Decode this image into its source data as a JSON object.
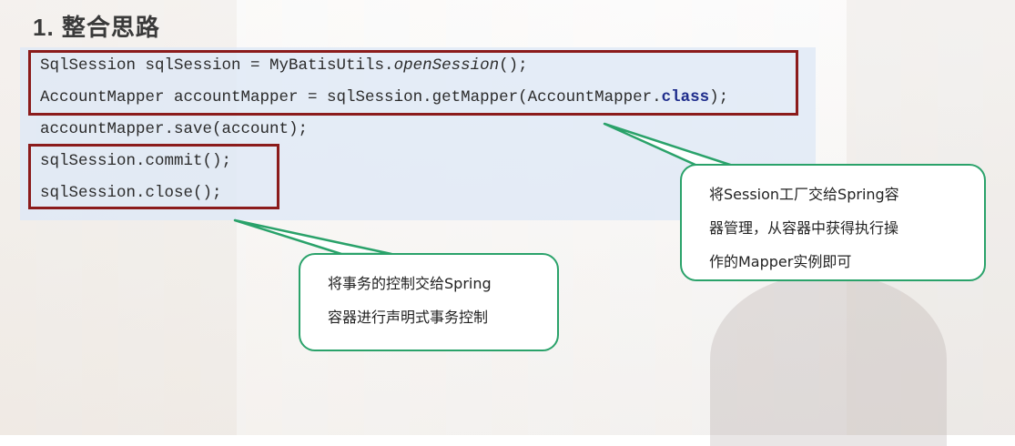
{
  "title": "1. 整合思路",
  "code": {
    "line1": {
      "a": "SqlSession sqlSession = MyBatisUtils.",
      "b": "openSession",
      "c": "();"
    },
    "line2": {
      "a": "AccountMapper accountMapper = sqlSession.getMapper(AccountMapper.",
      "kw": "class",
      "c": ");"
    },
    "line3": "accountMapper.save(account);",
    "line4": "sqlSession.commit();",
    "line5": "sqlSession.close();"
  },
  "callouts": {
    "factory": {
      "line1": "将Session工厂交给Spring容",
      "line2": "器管理，从容器中获得执行操",
      "line3": "作的Mapper实例即可"
    },
    "transaction": {
      "line1": "将事务的控制交给Spring",
      "line2": "容器进行声明式事务控制"
    }
  },
  "colors": {
    "highlight_border": "#8b1b1b",
    "callout_border": "#2aa26a",
    "code_background": "#dee8f6"
  }
}
